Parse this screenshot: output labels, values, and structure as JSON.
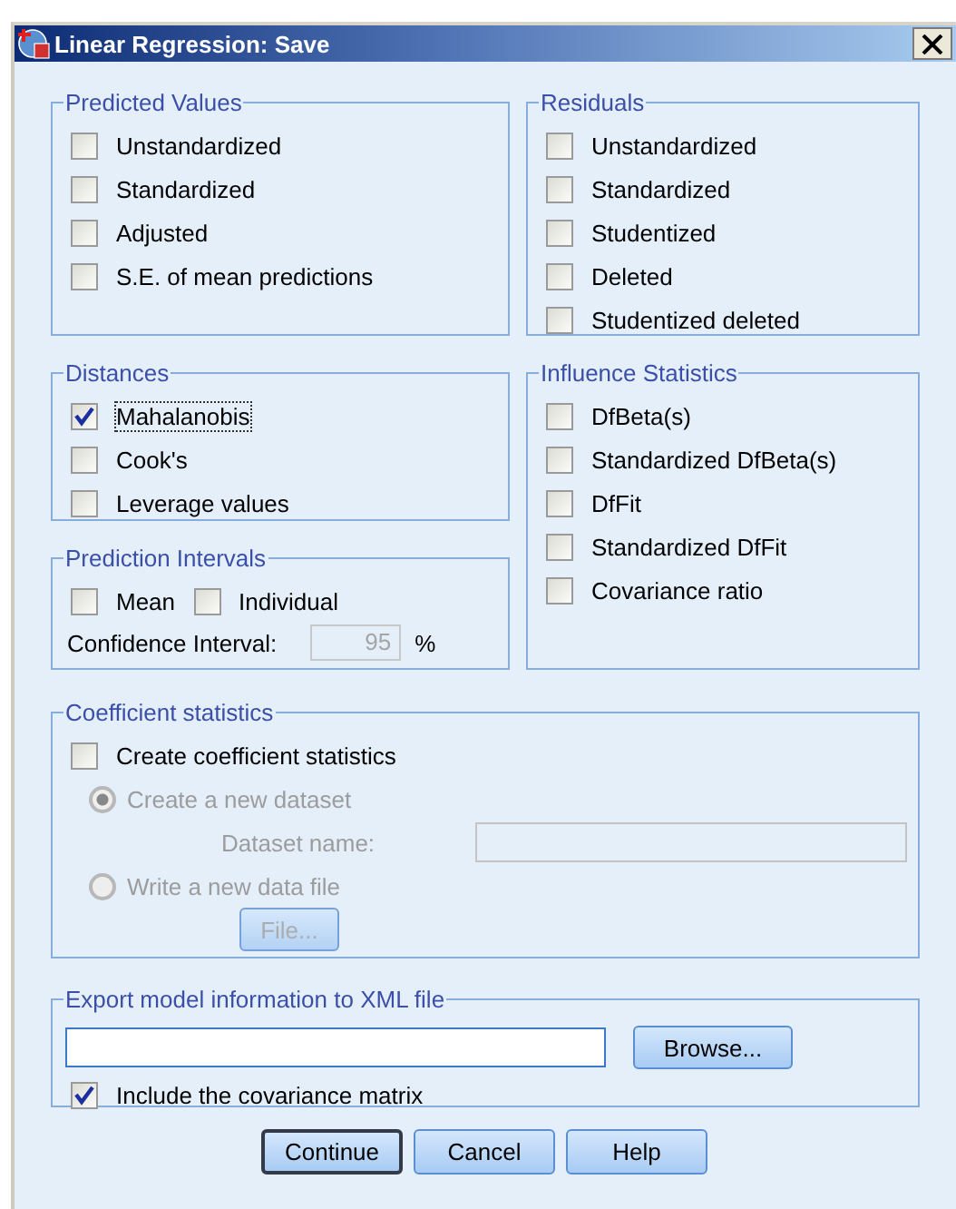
{
  "window": {
    "title": "Linear Regression: Save"
  },
  "predicted_values": {
    "title": "Predicted Values",
    "options": [
      {
        "label": "Unstandardized",
        "checked": false
      },
      {
        "label": "Standardized",
        "checked": false
      },
      {
        "label": "Adjusted",
        "checked": false
      },
      {
        "label": "S.E. of mean predictions",
        "checked": false
      }
    ]
  },
  "residuals": {
    "title": "Residuals",
    "options": [
      {
        "label": "Unstandardized",
        "checked": false
      },
      {
        "label": "Standardized",
        "checked": false
      },
      {
        "label": "Studentized",
        "checked": false
      },
      {
        "label": "Deleted",
        "checked": false
      },
      {
        "label": "Studentized deleted",
        "checked": false
      }
    ]
  },
  "distances": {
    "title": "Distances",
    "options": [
      {
        "label": "Mahalanobis",
        "checked": true,
        "focused": true
      },
      {
        "label": "Cook's",
        "checked": false,
        "focused": false
      },
      {
        "label": "Leverage values",
        "checked": false,
        "focused": false
      }
    ]
  },
  "prediction_intervals": {
    "title": "Prediction Intervals",
    "options": [
      {
        "label": "Mean",
        "checked": false
      },
      {
        "label": "Individual",
        "checked": false
      }
    ],
    "confidence_label": "Confidence Interval:",
    "confidence_value": "95",
    "unit": "%",
    "disabled": true
  },
  "influence_statistics": {
    "title": "Influence Statistics",
    "options": [
      {
        "label": "DfBeta(s)",
        "checked": false
      },
      {
        "label": "Standardized DfBeta(s)",
        "checked": false
      },
      {
        "label": "DfFit",
        "checked": false
      },
      {
        "label": "Standardized DfFit",
        "checked": false
      },
      {
        "label": "Covariance ratio",
        "checked": false
      }
    ]
  },
  "coefficient_statistics": {
    "title": "Coefficient statistics",
    "create": {
      "label": "Create coefficient statistics",
      "checked": false
    },
    "radios": [
      {
        "label": "Create a new dataset",
        "selected": true
      },
      {
        "label": "Write a new data file",
        "selected": false
      }
    ],
    "dataset_label": "Dataset name:",
    "file_button": "File...",
    "disabled": true
  },
  "export": {
    "title": "Export model information to XML file",
    "browse_button": "Browse...",
    "include": {
      "label": "Include the covariance matrix",
      "checked": true
    }
  },
  "buttons": [
    {
      "label": "Continue",
      "default": true
    },
    {
      "label": "Cancel",
      "default": false
    },
    {
      "label": "Help",
      "default": false
    }
  ]
}
